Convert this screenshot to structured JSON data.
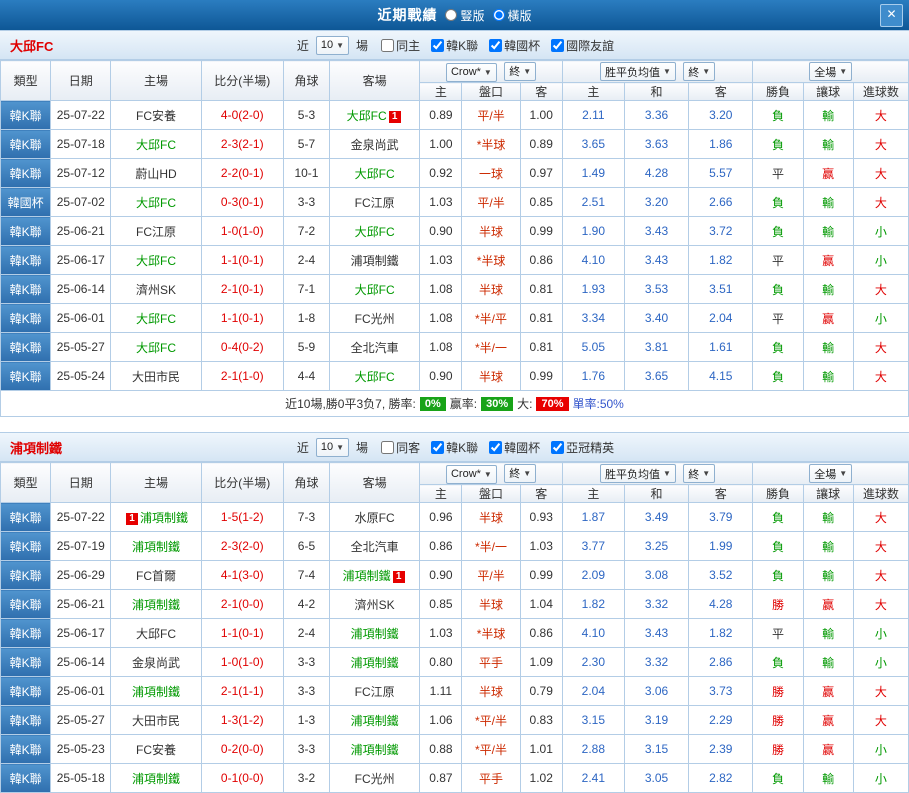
{
  "titlebar": {
    "title": "近期戰績",
    "options": [
      {
        "label": "豎版",
        "checked": false
      },
      {
        "label": "橫版",
        "checked": true
      }
    ],
    "close_icon": "✕"
  },
  "dropdown_arrow": "▼",
  "colors": {
    "titlebar_blue": "#15619f",
    "type_cell_blue": "#3c80c0",
    "team_name_red": "#e00000",
    "selected_team_green": "#009900",
    "score_red": "#e00000",
    "handicap_red": "#cc2a00",
    "mean_odds_blue": "#2d66c3",
    "result_win_red": "#e00000",
    "result_loss_green": "#009900",
    "rate_badge_green": "#18a318",
    "rate_badge_red": "#e80000"
  },
  "sections": [
    {
      "team": "大邱FC",
      "near_label": "近",
      "count": "10",
      "games_label": "場",
      "checkboxes": [
        {
          "label": "同主",
          "checked": false
        },
        {
          "label": "韓K聯",
          "checked": true
        },
        {
          "label": "韓國杯",
          "checked": true
        },
        {
          "label": "國際友誼",
          "checked": true
        }
      ],
      "header": {
        "type": "類型",
        "date": "日期",
        "home": "主場",
        "score": "比分(半場)",
        "corner": "角球",
        "away": "客場",
        "company_dd": "Crow*",
        "final_dd1": "終",
        "odds_dd": "胜平负均值",
        "final_dd2": "終",
        "scope_dd": "全場",
        "sub": [
          "主",
          "盤口",
          "客",
          "主",
          "和",
          "客",
          "勝負",
          "讓球",
          "進球数"
        ]
      },
      "rows": [
        {
          "type": "韓K聯",
          "date": "25-07-22",
          "home": "FC安養",
          "score": "4-0(2-0)",
          "corner": "5-3",
          "away": "大邱FC",
          "sel": "away",
          "badge": {
            "side": "away",
            "pos": "after",
            "text": "1"
          },
          "odds": [
            "0.89",
            "平/半",
            "1.00"
          ],
          "mean": [
            "2.11",
            "3.36",
            "3.20"
          ],
          "res": [
            "負",
            "輸",
            "大"
          ]
        },
        {
          "type": "韓K聯",
          "date": "25-07-18",
          "home": "大邱FC",
          "score": "2-3(2-1)",
          "corner": "5-7",
          "away": "金泉尚武",
          "sel": "home",
          "odds": [
            "1.00",
            "*半球",
            "0.89"
          ],
          "mean": [
            "3.65",
            "3.63",
            "1.86"
          ],
          "res": [
            "負",
            "輸",
            "大"
          ]
        },
        {
          "type": "韓K聯",
          "date": "25-07-12",
          "home": "蔚山HD",
          "score": "2-2(0-1)",
          "corner": "10-1",
          "away": "大邱FC",
          "sel": "away",
          "odds": [
            "0.92",
            "一球",
            "0.97"
          ],
          "mean": [
            "1.49",
            "4.28",
            "5.57"
          ],
          "res": [
            "平",
            "赢",
            "大"
          ]
        },
        {
          "type": "韓國杯",
          "date": "25-07-02",
          "home": "大邱FC",
          "score": "0-3(0-1)",
          "corner": "3-3",
          "away": "FC江原",
          "sel": "home",
          "odds": [
            "1.03",
            "平/半",
            "0.85"
          ],
          "mean": [
            "2.51",
            "3.20",
            "2.66"
          ],
          "res": [
            "負",
            "輸",
            "大"
          ]
        },
        {
          "type": "韓K聯",
          "date": "25-06-21",
          "home": "FC江原",
          "score": "1-0(1-0)",
          "corner": "7-2",
          "away": "大邱FC",
          "sel": "away",
          "odds": [
            "0.90",
            "半球",
            "0.99"
          ],
          "mean": [
            "1.90",
            "3.43",
            "3.72"
          ],
          "res": [
            "負",
            "輸",
            "小"
          ]
        },
        {
          "type": "韓K聯",
          "date": "25-06-17",
          "home": "大邱FC",
          "score": "1-1(0-1)",
          "corner": "2-4",
          "away": "浦項制鐵",
          "sel": "home",
          "odds": [
            "1.03",
            "*半球",
            "0.86"
          ],
          "mean": [
            "4.10",
            "3.43",
            "1.82"
          ],
          "res": [
            "平",
            "赢",
            "小"
          ]
        },
        {
          "type": "韓K聯",
          "date": "25-06-14",
          "home": "濟州SK",
          "score": "2-1(0-1)",
          "corner": "7-1",
          "away": "大邱FC",
          "sel": "away",
          "odds": [
            "1.08",
            "半球",
            "0.81"
          ],
          "mean": [
            "1.93",
            "3.53",
            "3.51"
          ],
          "res": [
            "負",
            "輸",
            "大"
          ]
        },
        {
          "type": "韓K聯",
          "date": "25-06-01",
          "home": "大邱FC",
          "score": "1-1(0-1)",
          "corner": "1-8",
          "away": "FC光州",
          "sel": "home",
          "odds": [
            "1.08",
            "*半/平",
            "0.81"
          ],
          "mean": [
            "3.34",
            "3.40",
            "2.04"
          ],
          "res": [
            "平",
            "赢",
            "小"
          ]
        },
        {
          "type": "韓K聯",
          "date": "25-05-27",
          "home": "大邱FC",
          "score": "0-4(0-2)",
          "corner": "5-9",
          "away": "全北汽車",
          "sel": "home",
          "odds": [
            "1.08",
            "*半/一",
            "0.81"
          ],
          "mean": [
            "5.05",
            "3.81",
            "1.61"
          ],
          "res": [
            "負",
            "輸",
            "大"
          ]
        },
        {
          "type": "韓K聯",
          "date": "25-05-24",
          "home": "大田市民",
          "score": "2-1(1-0)",
          "corner": "4-4",
          "away": "大邱FC",
          "sel": "away",
          "odds": [
            "0.90",
            "半球",
            "0.99"
          ],
          "mean": [
            "1.76",
            "3.65",
            "4.15"
          ],
          "res": [
            "負",
            "輸",
            "大"
          ]
        }
      ],
      "summary": {
        "prefix": "近10場,勝0平3负7, 勝率: ",
        "win_rate": "0%",
        "cover_label": "赢率: ",
        "cover_rate": "30%",
        "over_label": "大: ",
        "over_rate": "70%",
        "odd_label": "單率:50%"
      }
    },
    {
      "team": "浦項制鐵",
      "near_label": "近",
      "count": "10",
      "games_label": "場",
      "checkboxes": [
        {
          "label": "同客",
          "checked": false
        },
        {
          "label": "韓K聯",
          "checked": true
        },
        {
          "label": "韓國杯",
          "checked": true
        },
        {
          "label": "亞冠精英",
          "checked": true
        }
      ],
      "header": {
        "type": "類型",
        "date": "日期",
        "home": "主場",
        "score": "比分(半場)",
        "corner": "角球",
        "away": "客場",
        "company_dd": "Crow*",
        "final_dd1": "終",
        "odds_dd": "胜平负均值",
        "final_dd2": "終",
        "scope_dd": "全場",
        "sub": [
          "主",
          "盤口",
          "客",
          "主",
          "和",
          "客",
          "勝負",
          "讓球",
          "進球数"
        ]
      },
      "rows": [
        {
          "type": "韓K聯",
          "date": "25-07-22",
          "home": "浦項制鐵",
          "score": "1-5(1-2)",
          "corner": "7-3",
          "away": "水原FC",
          "sel": "home",
          "badge": {
            "side": "home",
            "pos": "before",
            "text": "1"
          },
          "odds": [
            "0.96",
            "半球",
            "0.93"
          ],
          "mean": [
            "1.87",
            "3.49",
            "3.79"
          ],
          "res": [
            "負",
            "輸",
            "大"
          ]
        },
        {
          "type": "韓K聯",
          "date": "25-07-19",
          "home": "浦項制鐵",
          "score": "2-3(2-0)",
          "corner": "6-5",
          "away": "全北汽車",
          "sel": "home",
          "odds": [
            "0.86",
            "*半/一",
            "1.03"
          ],
          "mean": [
            "3.77",
            "3.25",
            "1.99"
          ],
          "res": [
            "負",
            "輸",
            "大"
          ]
        },
        {
          "type": "韓K聯",
          "date": "25-06-29",
          "home": "FC首爾",
          "score": "4-1(3-0)",
          "corner": "7-4",
          "away": "浦項制鐵",
          "sel": "away",
          "badge": {
            "side": "away",
            "pos": "after",
            "text": "1"
          },
          "odds": [
            "0.90",
            "平/半",
            "0.99"
          ],
          "mean": [
            "2.09",
            "3.08",
            "3.52"
          ],
          "res": [
            "負",
            "輸",
            "大"
          ]
        },
        {
          "type": "韓K聯",
          "date": "25-06-21",
          "home": "浦項制鐵",
          "score": "2-1(0-0)",
          "corner": "4-2",
          "away": "濟州SK",
          "sel": "home",
          "odds": [
            "0.85",
            "半球",
            "1.04"
          ],
          "mean": [
            "1.82",
            "3.32",
            "4.28"
          ],
          "res": [
            "勝",
            "赢",
            "大"
          ]
        },
        {
          "type": "韓K聯",
          "date": "25-06-17",
          "home": "大邱FC",
          "score": "1-1(0-1)",
          "corner": "2-4",
          "away": "浦項制鐵",
          "sel": "away",
          "odds": [
            "1.03",
            "*半球",
            "0.86"
          ],
          "mean": [
            "4.10",
            "3.43",
            "1.82"
          ],
          "res": [
            "平",
            "輸",
            "小"
          ]
        },
        {
          "type": "韓K聯",
          "date": "25-06-14",
          "home": "金泉尚武",
          "score": "1-0(1-0)",
          "corner": "3-3",
          "away": "浦項制鐵",
          "sel": "away",
          "odds": [
            "0.80",
            "平手",
            "1.09"
          ],
          "mean": [
            "2.30",
            "3.32",
            "2.86"
          ],
          "res": [
            "負",
            "輸",
            "小"
          ]
        },
        {
          "type": "韓K聯",
          "date": "25-06-01",
          "home": "浦項制鐵",
          "score": "2-1(1-1)",
          "corner": "3-3",
          "away": "FC江原",
          "sel": "home",
          "odds": [
            "1.11",
            "半球",
            "0.79"
          ],
          "mean": [
            "2.04",
            "3.06",
            "3.73"
          ],
          "res": [
            "勝",
            "赢",
            "大"
          ]
        },
        {
          "type": "韓K聯",
          "date": "25-05-27",
          "home": "大田市民",
          "score": "1-3(1-2)",
          "corner": "1-3",
          "away": "浦項制鐵",
          "sel": "away",
          "odds": [
            "1.06",
            "*平/半",
            "0.83"
          ],
          "mean": [
            "3.15",
            "3.19",
            "2.29"
          ],
          "res": [
            "勝",
            "赢",
            "大"
          ]
        },
        {
          "type": "韓K聯",
          "date": "25-05-23",
          "home": "FC安養",
          "score": "0-2(0-0)",
          "corner": "3-3",
          "away": "浦項制鐵",
          "sel": "away",
          "odds": [
            "0.88",
            "*平/半",
            "1.01"
          ],
          "mean": [
            "2.88",
            "3.15",
            "2.39"
          ],
          "res": [
            "勝",
            "赢",
            "小"
          ]
        },
        {
          "type": "韓K聯",
          "date": "25-05-18",
          "home": "浦項制鐵",
          "score": "0-1(0-0)",
          "corner": "3-2",
          "away": "FC光州",
          "sel": "home",
          "odds": [
            "0.87",
            "平手",
            "1.02"
          ],
          "mean": [
            "2.41",
            "3.05",
            "2.82"
          ],
          "res": [
            "負",
            "輸",
            "小"
          ]
        }
      ]
    }
  ]
}
